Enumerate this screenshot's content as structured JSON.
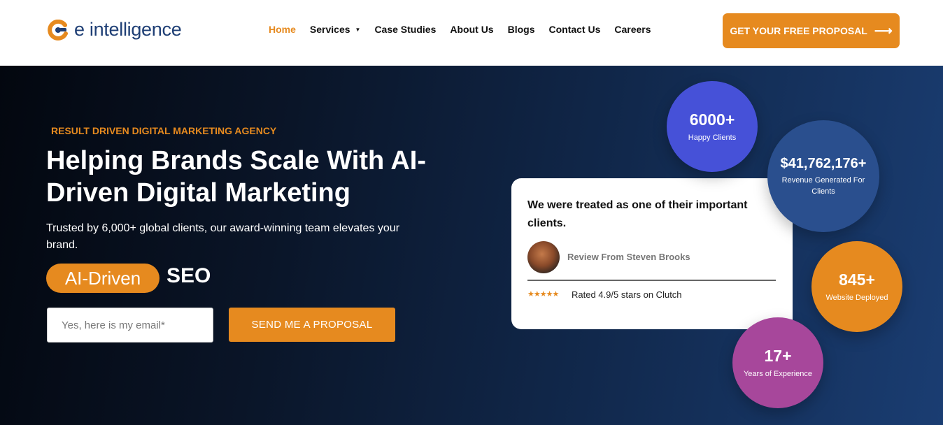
{
  "brand": {
    "name": "e intelligence",
    "colors": {
      "accent": "#e68a1f",
      "navy": "#1f3f75",
      "purple": "#a7479b",
      "blue": "#4651d8"
    }
  },
  "nav": {
    "items": [
      {
        "label": "Home",
        "active": true
      },
      {
        "label": "Services",
        "has_dropdown": true
      },
      {
        "label": "Case Studies"
      },
      {
        "label": "About Us"
      },
      {
        "label": "Blogs"
      },
      {
        "label": "Contact Us"
      },
      {
        "label": "Careers"
      }
    ],
    "cta_label": "GET YOUR FREE PROPOSAL"
  },
  "hero": {
    "tagline": "RESULT DRIVEN DIGITAL MARKETING AGENCY",
    "headline": "Helping Brands Scale With AI-Driven Digital Marketing",
    "subtext": "Trusted by 6,000+ global clients, our award-winning team elevates your brand.",
    "pill": "AI-Driven",
    "pill_suffix": "SEO",
    "email_placeholder": "Yes, here is my email*",
    "send_label": "SEND ME A PROPOSAL"
  },
  "review": {
    "quote": "We were treated as one of their important clients.",
    "reviewer": "Review From Steven Brooks",
    "stars": "★★★★★",
    "rating_text": "Rated 4.9/5 stars on Clutch"
  },
  "stats": [
    {
      "value": "6000+",
      "label": "Happy Clients"
    },
    {
      "value": "$41,762,176+",
      "label": "Revenue Generated For Clients"
    },
    {
      "value": "845+",
      "label": "Website Deployed"
    },
    {
      "value": "17+",
      "label": "Years of Experience"
    }
  ]
}
